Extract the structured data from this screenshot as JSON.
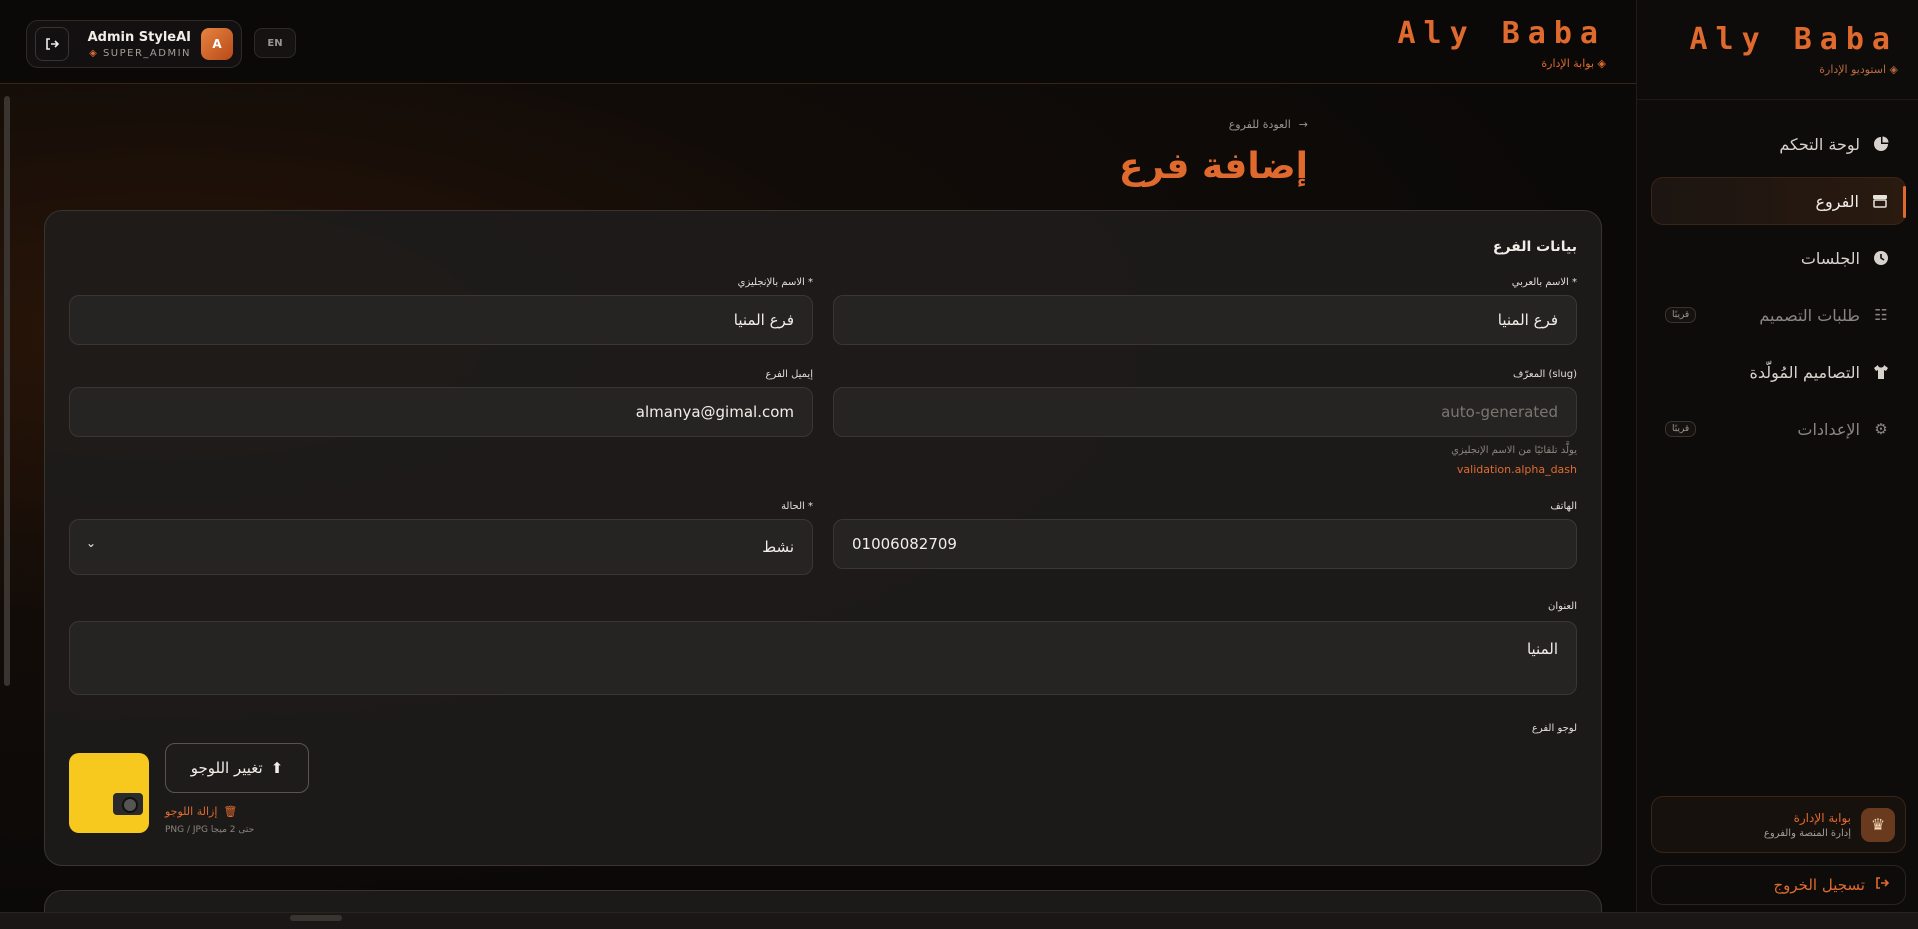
{
  "brand": {
    "name": "Aly Baba",
    "sidebar_subtitle": "استوديو الإدارة",
    "topbar_subtitle": "بوابة الإدارة"
  },
  "user": {
    "name": "Admin StyleAI",
    "role": "SUPER_ADMIN",
    "initial": "A"
  },
  "lang_button": "EN",
  "sidebar": {
    "items": [
      {
        "label": "لوحة التحكم",
        "icon": "pie-chart-icon",
        "active": false,
        "soon": ""
      },
      {
        "label": "الفروع",
        "icon": "store-icon",
        "active": true,
        "soon": ""
      },
      {
        "label": "الجلسات",
        "icon": "clock-icon",
        "active": false,
        "soon": ""
      },
      {
        "label": "طلبات التصميم",
        "icon": "checklist-icon",
        "active": false,
        "soon": "قريبًا"
      },
      {
        "label": "التصاميم المُولّدة",
        "icon": "shirt-icon",
        "active": false,
        "soon": ""
      },
      {
        "label": "الإعدادات",
        "icon": "gear-icon",
        "active": false,
        "soon": "قريبًا"
      }
    ],
    "portal": {
      "title": "بوابة الإدارة",
      "subtitle": "إدارة المنصة والفروع"
    },
    "logout": "تسجيل الخروج"
  },
  "page": {
    "back_link": "العودة للفروع",
    "title": "إضافة فرع"
  },
  "form": {
    "section_title": "بيانات الفرع",
    "name_ar": {
      "label": "الاسم بالعربي *",
      "value": "فرع المنيا"
    },
    "name_en": {
      "label": "الاسم بالإنجليزي *",
      "value": "فرع المنيا"
    },
    "slug": {
      "label": "المعرّف (slug)",
      "placeholder": "auto-generated",
      "hint": "يولَّد تلقائيًا من الاسم الإنجليزي",
      "error": "validation.alpha_dash"
    },
    "email": {
      "label": "إيميل الفرع",
      "value": "almanya@gimal.com"
    },
    "phone": {
      "label": "الهاتف",
      "value": "01006082709"
    },
    "status": {
      "label": "الحالة *",
      "value": "نشط"
    },
    "address": {
      "label": "العنوان",
      "value": "المنيا"
    },
    "logo": {
      "label": "لوجو الفرع",
      "change_button": "تغيير اللوجو",
      "remove": "إزالة اللوجو",
      "note": "PNG / JPG حتى 2 ميجا"
    }
  },
  "colors": {
    "accent": "#e06a2e",
    "background": "#0b0908",
    "card": "#1e1c1b"
  }
}
